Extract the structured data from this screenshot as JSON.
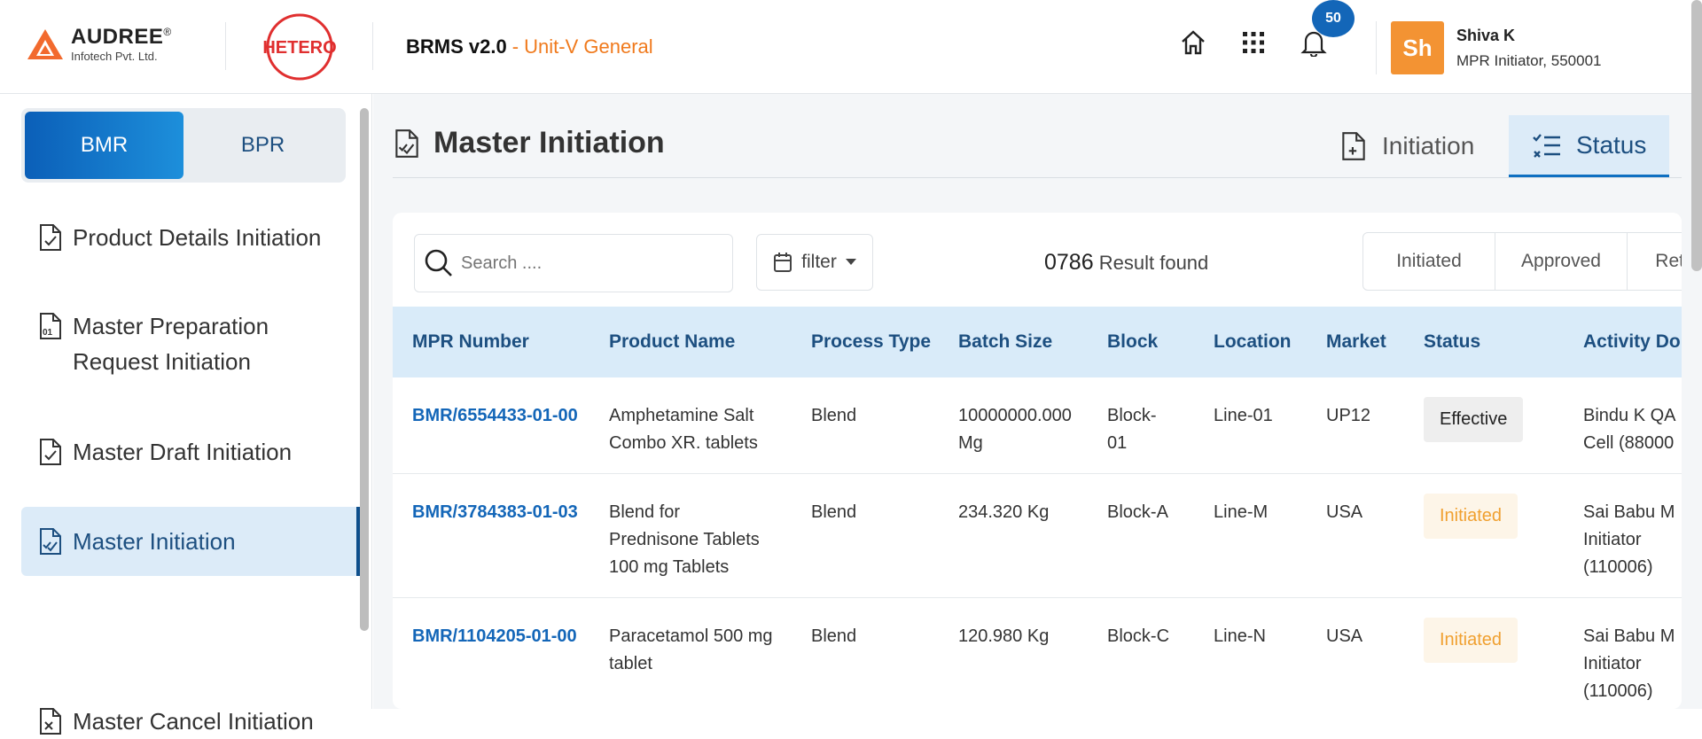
{
  "header": {
    "company_name": "AUDREE",
    "company_reg": "®",
    "company_sub": "Infotech Pvt. Ltd.",
    "partner_logo": "HETERO",
    "app_name": "BRMS v2.0",
    "unit": "- Unit-V General",
    "notification_count": "50",
    "user": {
      "initials": "Sh",
      "name": "Shiva K",
      "role": "MPR Initiator, 550001"
    },
    "icons": [
      "home-icon",
      "apps-grid-icon",
      "bell-icon"
    ]
  },
  "sidebar": {
    "toggle": [
      "BMR",
      "BPR"
    ],
    "items": [
      {
        "line1": "Product Details Initiation",
        "line2": ""
      },
      {
        "line1": "Master Preparation",
        "line2": "Request Initiation"
      },
      {
        "line1": "Master Draft Initiation",
        "line2": ""
      },
      {
        "line1": "Master Initiation",
        "line2": ""
      },
      {
        "line1": "Master Cancel Initiation",
        "line2": ""
      }
    ]
  },
  "main": {
    "title": "Master Initiation",
    "tabs": [
      "Initiation",
      "Status"
    ],
    "search_placeholder": "Search ....",
    "filter_label": "filter",
    "result_count": "0786",
    "result_text": "Result found",
    "status_filters": [
      "Initiated",
      "Approved",
      "Returned"
    ],
    "columns": [
      "MPR Number",
      "Product Name",
      "Process Type",
      "Batch Size",
      "Block",
      "Location",
      "Market",
      "Status",
      "Activity Do"
    ],
    "rows": [
      {
        "mpr": "BMR/6554433-01-00",
        "product": [
          "Amphetamine Salt",
          "Combo XR. tablets"
        ],
        "process": "Blend",
        "batch": [
          "10000000.000",
          "Mg"
        ],
        "block": [
          "Block-",
          "01"
        ],
        "location": "Line-01",
        "market": "UP12",
        "status": "Effective",
        "activity": [
          "Bindu K QA",
          "Cell (88000"
        ]
      },
      {
        "mpr": "BMR/3784383-01-03",
        "product": [
          "Blend for",
          "Prednisone Tablets",
          "100 mg Tablets"
        ],
        "process": "Blend",
        "batch": [
          "234.320 Kg"
        ],
        "block": [
          "Block-A"
        ],
        "location": "Line-M",
        "market": "USA",
        "status": "Initiated",
        "activity": [
          "Sai Babu M",
          "Initiator",
          "(110006)"
        ]
      },
      {
        "mpr": "BMR/1104205-01-00",
        "product": [
          "Paracetamol 500 mg",
          "tablet"
        ],
        "process": "Blend",
        "batch": [
          "120.980 Kg"
        ],
        "block": [
          "Block-C"
        ],
        "location": "Line-N",
        "market": "USA",
        "status": "Initiated",
        "activity": [
          "Sai Babu M",
          "Initiator",
          "(110006)"
        ]
      }
    ]
  },
  "colors": {
    "primary": "#1366b8",
    "accent_orange": "#f07a1d",
    "avatar_bg": "#f39333",
    "header_row_bg": "#d9ebf9",
    "initiated_text": "#f0a030"
  }
}
